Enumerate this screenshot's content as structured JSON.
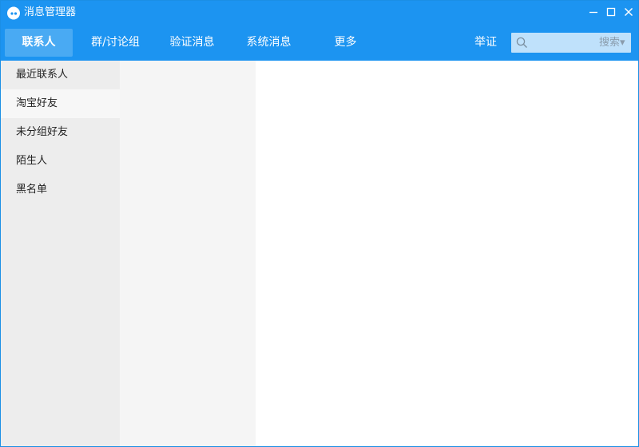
{
  "window": {
    "title": "消息管理器",
    "controls": {
      "minimize_icon": "minimize-icon",
      "maximize_icon": "maximize-icon",
      "close_icon": "close-icon"
    }
  },
  "nav": {
    "tabs": [
      {
        "label": "联系人",
        "active": true
      },
      {
        "label": "群/讨论组",
        "active": false
      },
      {
        "label": "验证消息",
        "active": false
      },
      {
        "label": "系统消息",
        "active": false
      },
      {
        "label": "更多",
        "active": false
      }
    ],
    "report_label": "举证"
  },
  "search": {
    "value": "",
    "placeholder": "",
    "scope_label": "搜索▾",
    "icon": "search-icon"
  },
  "sidebar": {
    "items": [
      {
        "label": "最近联系人"
      },
      {
        "label": "淘宝好友",
        "selected": true
      },
      {
        "label": "未分组好友"
      },
      {
        "label": "陌生人"
      },
      {
        "label": "黑名单"
      }
    ]
  },
  "colors": {
    "header_bg": "#1c94f1",
    "active_tab_bg": "#49aaf3",
    "search_bg": "#bfe1fb",
    "sidebar_bg": "#ededed",
    "sidebar_selected_bg": "#f7f7f7",
    "list_bg": "#f5f5f5"
  }
}
